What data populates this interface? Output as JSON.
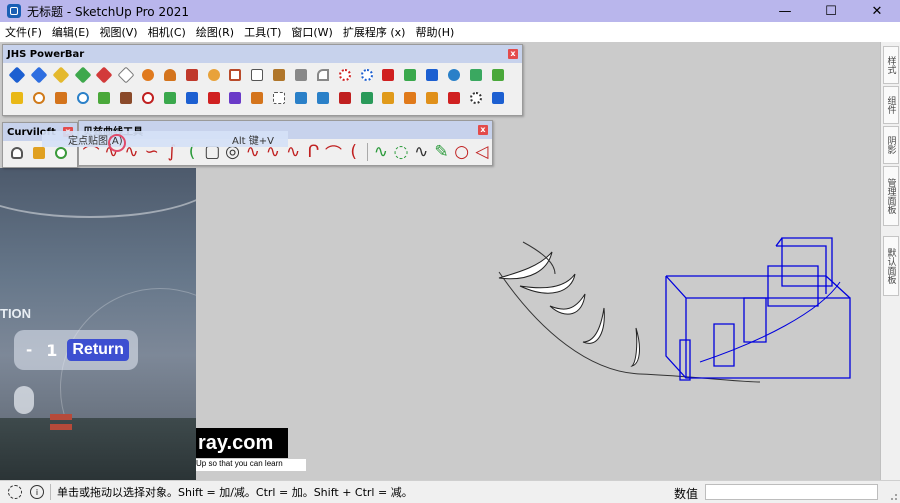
{
  "window": {
    "title": "无标题 - SketchUp Pro 2021",
    "minimize": "—",
    "maximize": "☐",
    "close": "✕"
  },
  "menu": [
    "文件(F)",
    "编辑(E)",
    "视图(V)",
    "相机(C)",
    "绘图(R)",
    "工具(T)",
    "窗口(W)",
    "扩展程序 (x)",
    "帮助(H)"
  ],
  "toolbars": {
    "jhs": {
      "title": "JHS PowerBar",
      "close": "x"
    },
    "curviloft": {
      "title": "Curviloft",
      "close": "x"
    },
    "bezier": {
      "title": "贝兹曲线工具",
      "close": "x"
    }
  },
  "tooltip": {
    "text": "定点贴图(A)",
    "hotkey": "Alt 键+V"
  },
  "video": {
    "partial_word": "TION",
    "minus": "-",
    "count": "1",
    "return_label": "Return"
  },
  "brand": {
    "logo_text": "ray.com",
    "caption": "Up so that you can learn"
  },
  "tray_tabs": [
    "样式",
    "组件",
    "阴影",
    "管理面板",
    "默认面板"
  ],
  "status": {
    "info_icon": "i",
    "hint": "单击或拖动以选择对象。Shift = 加/减。Ctrl = 加。Shift + Ctrl = 减。",
    "value_label": "数值",
    "value": ""
  },
  "colors": {
    "titlebar": "#b9b6ec",
    "toolbar_head": "#c7d2ec",
    "selection_blue": "#0000dd",
    "return_button": "#3d4fd1"
  }
}
